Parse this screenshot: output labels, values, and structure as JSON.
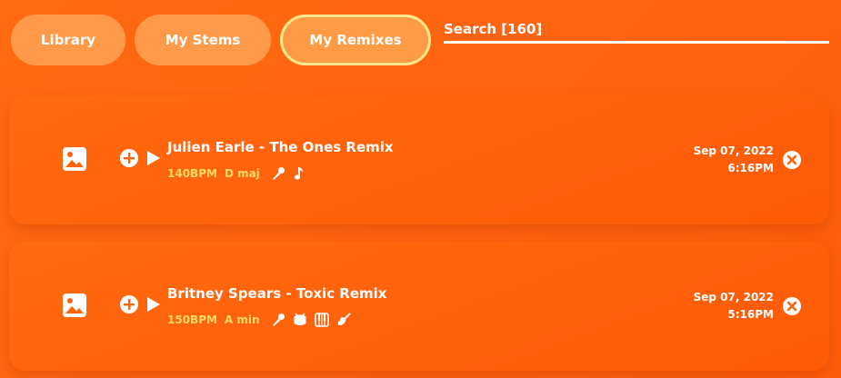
{
  "tabs": [
    {
      "label": "Library"
    },
    {
      "label": "My Stems"
    },
    {
      "label": "My Remixes",
      "active": true
    }
  ],
  "search": {
    "label": "Search [160]"
  },
  "colors": {
    "accent": "#ff6410",
    "active_border": "#ffe98a",
    "meta": "#ffd966"
  },
  "remixes": [
    {
      "title": "Julien Earle - The Ones Remix",
      "bpm": "140BPM",
      "key": "D maj",
      "stems": [
        "microphone-icon",
        "music-note-icon"
      ],
      "date": "Sep 07, 2022",
      "time": "6:16PM"
    },
    {
      "title": "Britney Spears - Toxic Remix",
      "bpm": "150BPM",
      "key": "A min",
      "stems": [
        "microphone-icon",
        "drum-icon",
        "piano-icon",
        "guitar-icon"
      ],
      "date": "Sep 07, 2022",
      "time": "5:16PM"
    }
  ]
}
